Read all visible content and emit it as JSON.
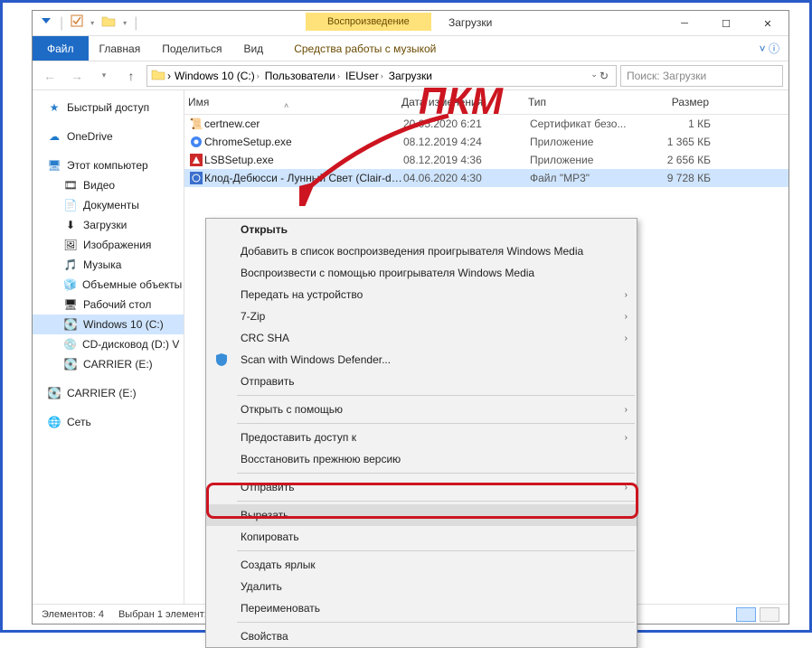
{
  "window": {
    "title": "Загрузки"
  },
  "titlebar_contextual": "Воспроизведение",
  "ribbon": {
    "file": "Файл",
    "home": "Главная",
    "share": "Поделиться",
    "view": "Вид",
    "contextual": "Средства работы с музыкой"
  },
  "breadcrumb": {
    "parts": [
      "Windows 10 (C:)",
      "Пользователи",
      "IEUser",
      "Загрузки"
    ]
  },
  "search": {
    "placeholder": "Поиск: Загрузки"
  },
  "sidebar": {
    "quick": "Быстрый доступ",
    "onedrive": "OneDrive",
    "thispc": "Этот компьютер",
    "subs": [
      "Видео",
      "Документы",
      "Загрузки",
      "Изображения",
      "Музыка",
      "Объемные объекты",
      "Рабочий стол",
      "Windows 10 (C:)",
      "CD-дисковод (D:) V",
      "CARRIER (E:)"
    ],
    "carrier2": "CARRIER (E:)",
    "network": "Сеть"
  },
  "columns": {
    "name": "Имя",
    "date": "Дата изменения",
    "type": "Тип",
    "size": "Размер"
  },
  "files": [
    {
      "icon": "cert",
      "name": "certnew.cer",
      "date": "20.05.2020 6:21",
      "type": "Сертификат безо...",
      "size": "1 КБ"
    },
    {
      "icon": "chrome",
      "name": "ChromeSetup.exe",
      "date": "08.12.2019 4:24",
      "type": "Приложение",
      "size": "1 365 КБ"
    },
    {
      "icon": "exe",
      "name": "LSBSetup.exe",
      "date": "08.12.2019 4:36",
      "type": "Приложение",
      "size": "2 656 КБ"
    },
    {
      "icon": "mp3",
      "name": "Клод-Дебюсси - Лунный Свет (Clair-de...",
      "date": "04.06.2020 4:30",
      "type": "Файл \"MP3\"",
      "size": "9 728 КБ"
    }
  ],
  "status": {
    "elements": "Элементов: 4",
    "selected": "Выбран 1 элемент:"
  },
  "ctx": {
    "open": "Открыть",
    "add_wmp": "Добавить в список воспроизведения проигрывателя Windows Media",
    "play_wmp": "Воспроизвести с помощью проигрывателя Windows Media",
    "cast": "Передать на устройство",
    "sevenzip": "7-Zip",
    "crc": "CRC SHA",
    "defender": "Scan with Windows Defender...",
    "send": "Отправить",
    "openwith": "Открыть с помощью",
    "grant": "Предоставить доступ к",
    "restore": "Восстановить прежнюю версию",
    "sendto": "Отправить",
    "cut": "Вырезать",
    "copy": "Копировать",
    "shortcut": "Создать ярлык",
    "delete": "Удалить",
    "rename": "Переименовать",
    "props": "Свойства"
  },
  "annotation": {
    "label": "ПКМ"
  }
}
